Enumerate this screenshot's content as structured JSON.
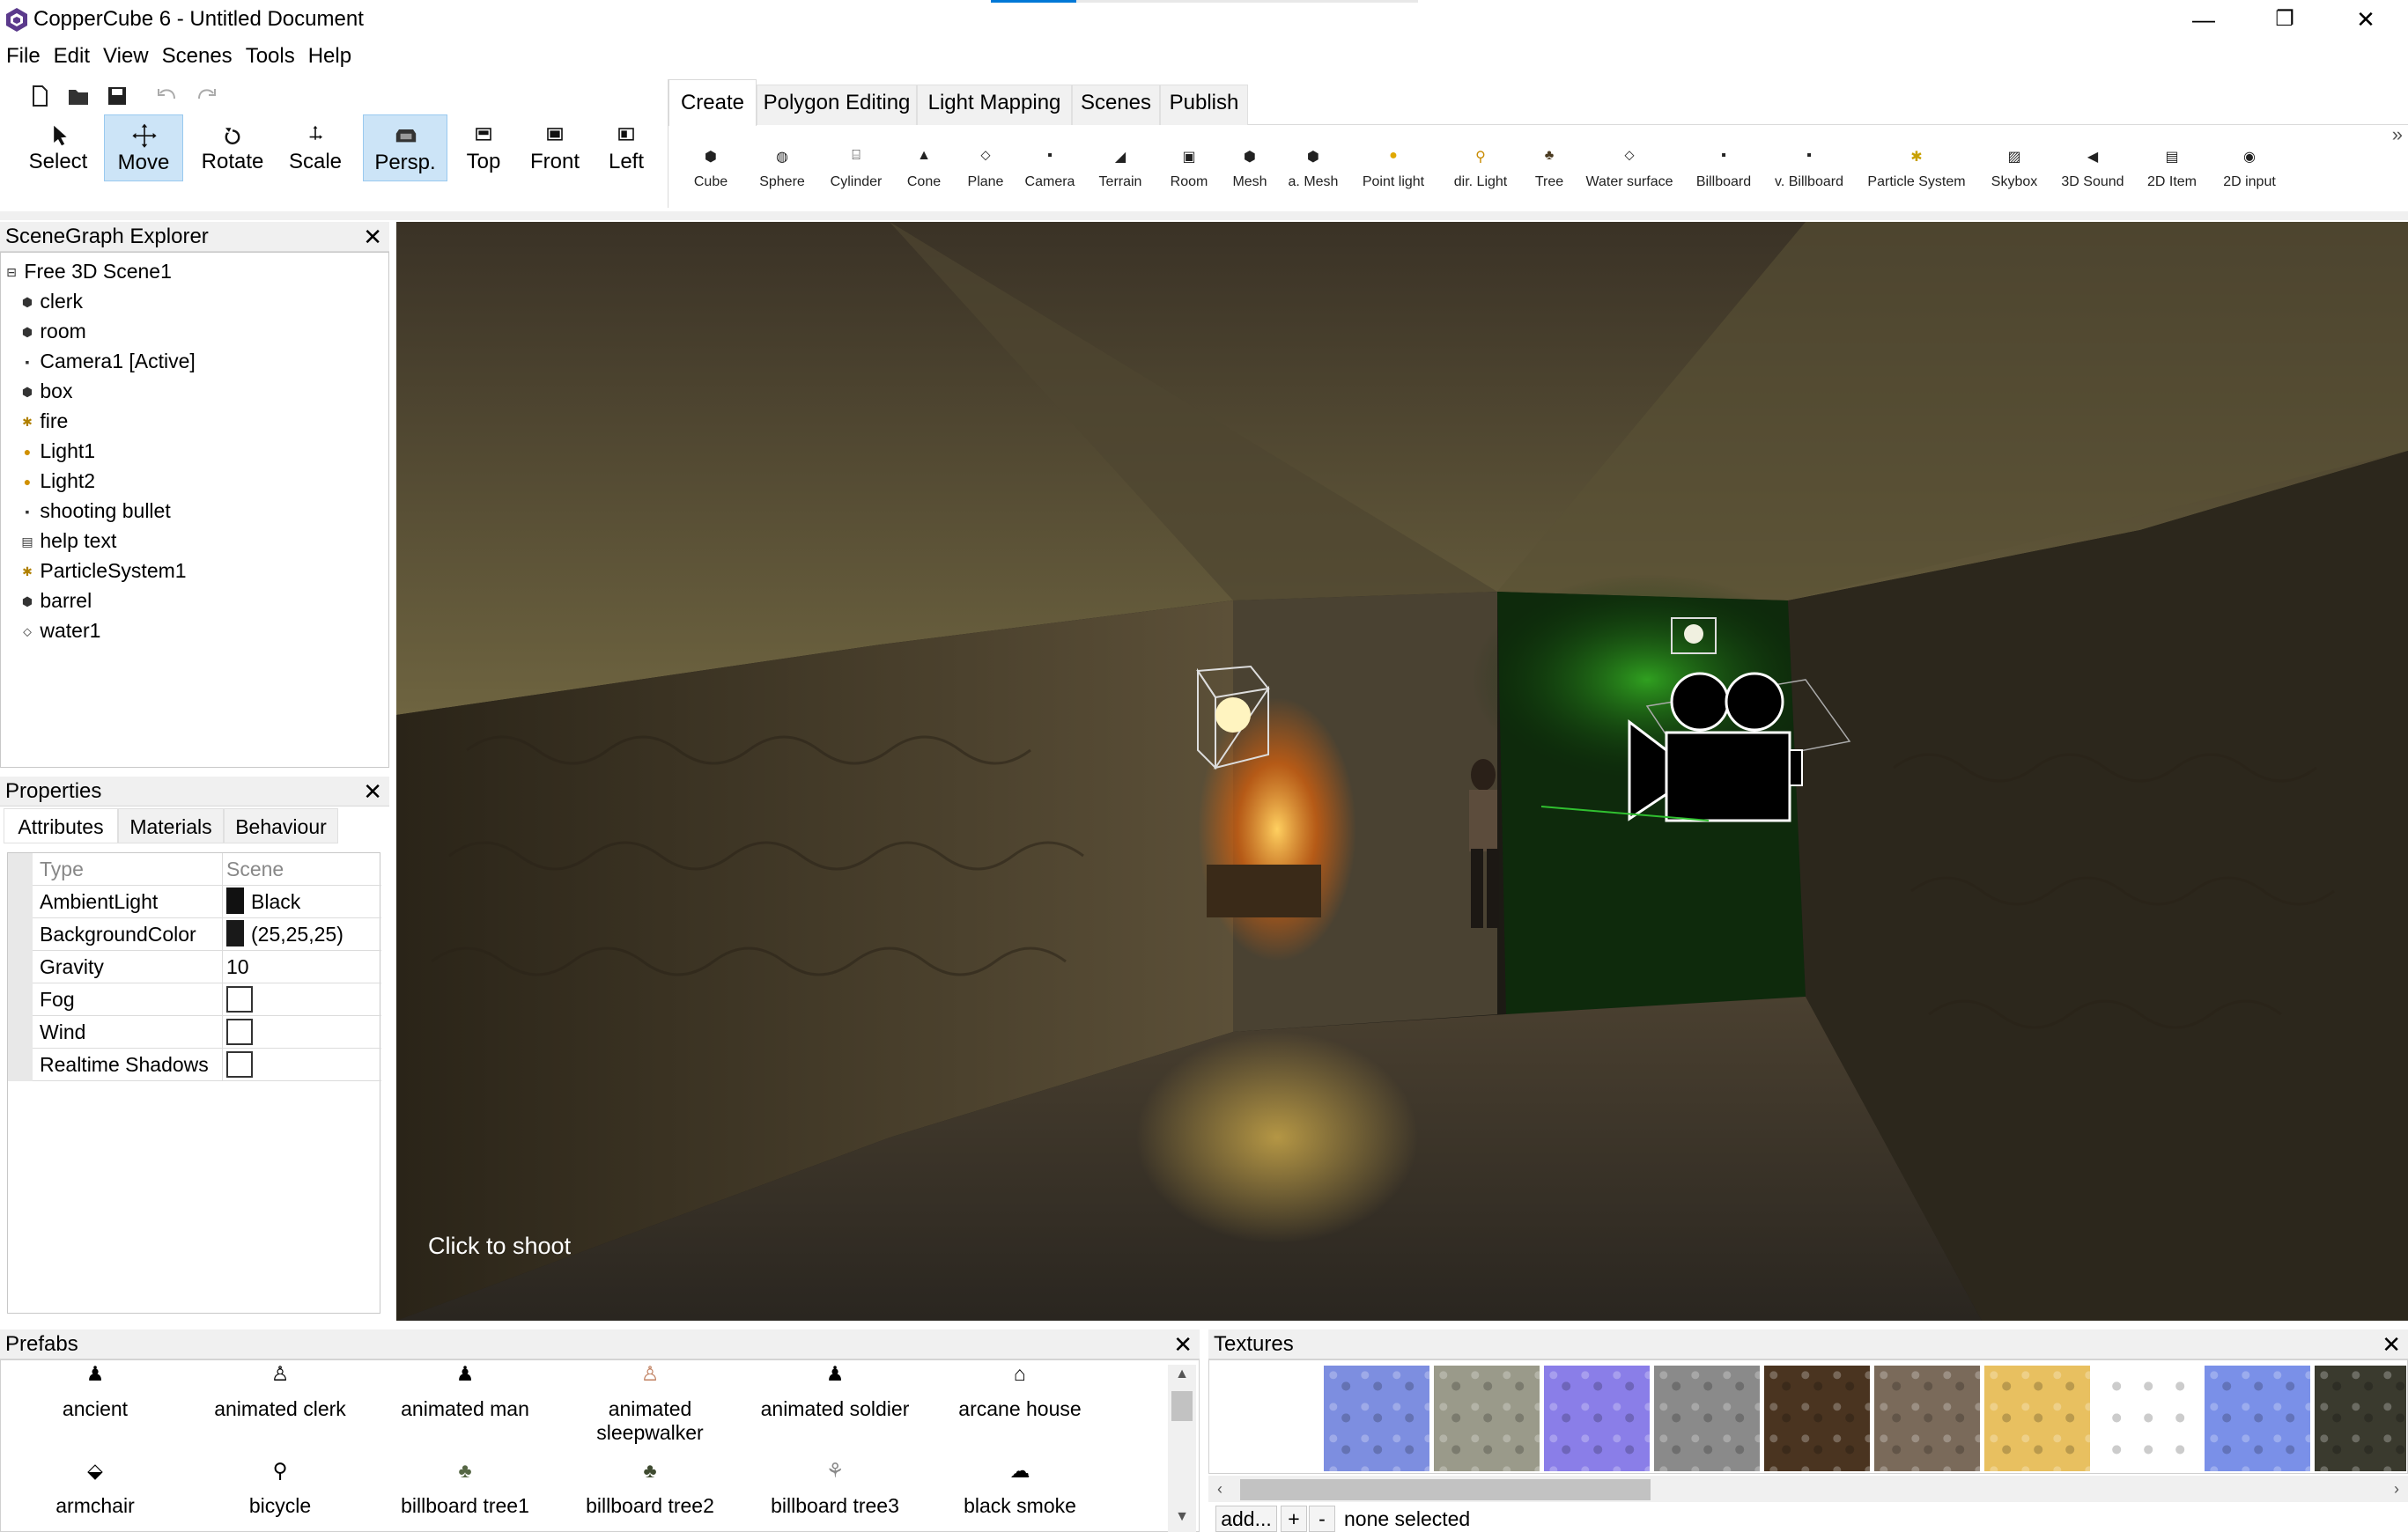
{
  "window": {
    "title": "CopperCube 6 - Untitled Document",
    "controls": {
      "minimize": "—",
      "maximize": "❐",
      "close": "✕"
    }
  },
  "menu": [
    "File",
    "Edit",
    "View",
    "Scenes",
    "Tools",
    "Help"
  ],
  "toolbar": {
    "tools": [
      {
        "label": "Select",
        "icon": "cursor-icon"
      },
      {
        "label": "Move",
        "icon": "move-icon",
        "active": true
      },
      {
        "label": "Rotate",
        "icon": "rotate-icon"
      },
      {
        "label": "Scale",
        "icon": "scale-icon"
      }
    ],
    "views": [
      {
        "label": "Persp.",
        "icon": "perspective-icon",
        "active": true
      },
      {
        "label": "Top",
        "icon": "top-view-icon"
      },
      {
        "label": "Front",
        "icon": "front-view-icon"
      },
      {
        "label": "Left",
        "icon": "left-view-icon"
      }
    ]
  },
  "ribbon": {
    "tabs": [
      "Create",
      "Polygon Editing",
      "Light Mapping",
      "Scenes",
      "Publish"
    ],
    "active_tab": "Create",
    "items": [
      "Cube",
      "Sphere",
      "Cylinder",
      "Cone",
      "Plane",
      "Camera",
      "Terrain",
      "Room",
      "Mesh",
      "a. Mesh",
      "Point light",
      "dir. Light",
      "Tree",
      "Water surface",
      "Billboard",
      "v. Billboard",
      "Particle System",
      "Skybox",
      "3D Sound",
      "2D Item",
      "2D input"
    ],
    "more": "»"
  },
  "scenegraph": {
    "title": "SceneGraph Explorer",
    "close": "✕",
    "root": "Free 3D Scene1",
    "nodes": [
      "clerk",
      "room",
      "Camera1 [Active]",
      "box",
      "fire",
      "Light1",
      "Light2",
      "shooting bullet",
      "help text",
      "ParticleSystem1",
      "barrel",
      "water1"
    ]
  },
  "properties": {
    "title": "Properties",
    "close": "✕",
    "tabs": [
      "Attributes",
      "Materials",
      "Behaviour"
    ],
    "header": {
      "key": "Type",
      "value": "Scene"
    },
    "rows": [
      {
        "key": "AmbientLight",
        "value": "Black",
        "kind": "color"
      },
      {
        "key": "BackgroundColor",
        "value": "(25,25,25)",
        "kind": "color"
      },
      {
        "key": "Gravity",
        "value": "10",
        "kind": "text"
      },
      {
        "key": "Fog",
        "value": "",
        "kind": "checkbox"
      },
      {
        "key": "Wind",
        "value": "",
        "kind": "checkbox"
      },
      {
        "key": "Realtime Shadows",
        "value": "",
        "kind": "checkbox"
      }
    ]
  },
  "viewport": {
    "hint": "Click to shoot"
  },
  "prefabs": {
    "title": "Prefabs",
    "close": "✕",
    "items": [
      "ancient",
      "animated clerk",
      "animated man",
      "animated sleepwalker",
      "animated soldier",
      "arcane house",
      "armchair",
      "bicycle",
      "billboard tree1",
      "billboard tree2",
      "billboard tree3",
      "black smoke"
    ]
  },
  "textures": {
    "title": "Textures",
    "close": "✕",
    "swatches": [
      "#7d8ee0",
      "#9a9a8a",
      "#8a7ee8",
      "#8a8a8a",
      "#4a3420",
      "#7a6a5a",
      "#e8c060",
      "#ffffff",
      "#7a90e8",
      "#3a3a2e"
    ],
    "footer": {
      "add": "add...",
      "plus": "+",
      "minus": "-",
      "status": "none selected"
    }
  }
}
